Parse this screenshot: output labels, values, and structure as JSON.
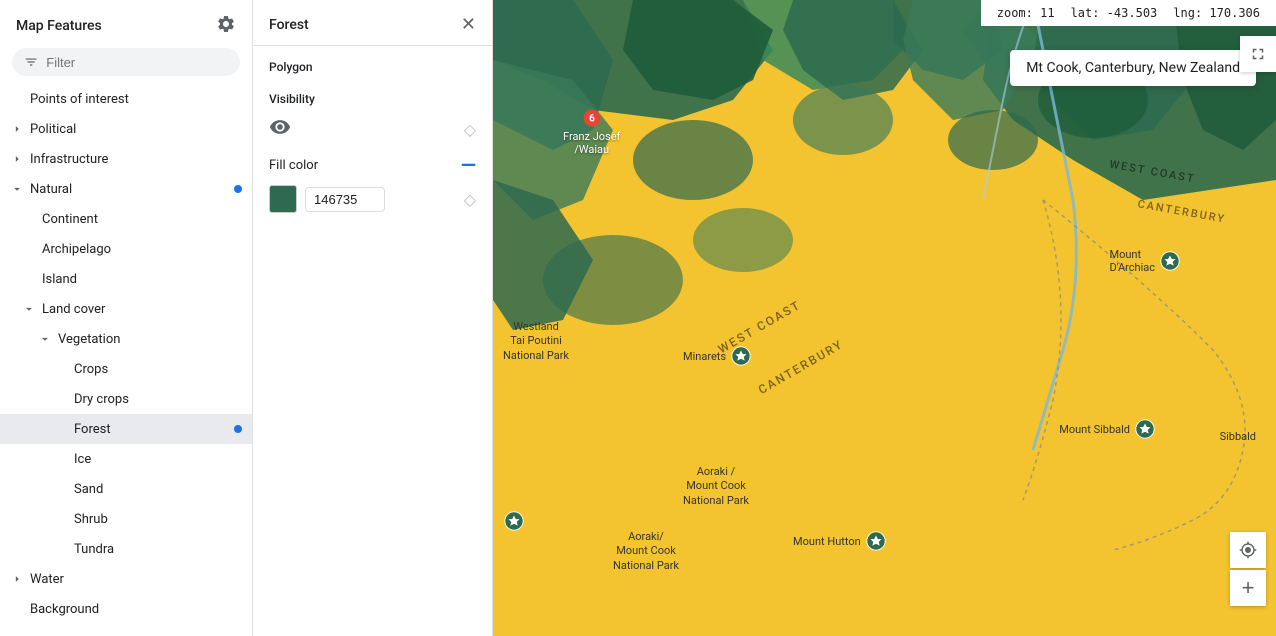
{
  "app": {
    "title": "Map Features",
    "filter_placeholder": "Filter"
  },
  "forest_panel": {
    "title": "Forest",
    "section_polygon": "Polygon",
    "section_visibility": "Visibility",
    "section_fill_color": "Fill color",
    "hex_value": "146735"
  },
  "map": {
    "zoom_label": "zoom:",
    "zoom_value": "11",
    "lat_label": "lat:",
    "lat_value": "-43.503",
    "lng_label": "lng:",
    "lng_value": "170.306",
    "location_name": "Mt Cook, Canterbury, New Zealand"
  },
  "sidebar": {
    "items": [
      {
        "id": "points-of-interest",
        "label": "Points of interest",
        "indent": 1,
        "has_chevron": false,
        "chevron_open": false,
        "active": false,
        "has_dot": false
      },
      {
        "id": "political",
        "label": "Political",
        "indent": 1,
        "has_chevron": true,
        "chevron_open": false,
        "active": false,
        "has_dot": false
      },
      {
        "id": "infrastructure",
        "label": "Infrastructure",
        "indent": 1,
        "has_chevron": true,
        "chevron_open": false,
        "active": false,
        "has_dot": false
      },
      {
        "id": "natural",
        "label": "Natural",
        "indent": 1,
        "has_chevron": true,
        "chevron_open": true,
        "active": false,
        "has_dot": true
      },
      {
        "id": "continent",
        "label": "Continent",
        "indent": 2,
        "has_chevron": false,
        "chevron_open": false,
        "active": false,
        "has_dot": false
      },
      {
        "id": "archipelago",
        "label": "Archipelago",
        "indent": 2,
        "has_chevron": false,
        "chevron_open": false,
        "active": false,
        "has_dot": false
      },
      {
        "id": "island",
        "label": "Island",
        "indent": 2,
        "has_chevron": false,
        "chevron_open": false,
        "active": false,
        "has_dot": false
      },
      {
        "id": "land-cover",
        "label": "Land cover",
        "indent": 2,
        "has_chevron": true,
        "chevron_open": true,
        "active": false,
        "has_dot": false
      },
      {
        "id": "vegetation",
        "label": "Vegetation",
        "indent": 3,
        "has_chevron": true,
        "chevron_open": true,
        "active": false,
        "has_dot": false
      },
      {
        "id": "crops",
        "label": "Crops",
        "indent": 4,
        "has_chevron": false,
        "chevron_open": false,
        "active": false,
        "has_dot": false
      },
      {
        "id": "dry-crops",
        "label": "Dry crops",
        "indent": 4,
        "has_chevron": false,
        "chevron_open": false,
        "active": false,
        "has_dot": false
      },
      {
        "id": "forest",
        "label": "Forest",
        "indent": 4,
        "has_chevron": false,
        "chevron_open": false,
        "active": true,
        "has_dot": true
      },
      {
        "id": "ice",
        "label": "Ice",
        "indent": 4,
        "has_chevron": false,
        "chevron_open": false,
        "active": false,
        "has_dot": false
      },
      {
        "id": "sand",
        "label": "Sand",
        "indent": 4,
        "has_chevron": false,
        "chevron_open": false,
        "active": false,
        "has_dot": false
      },
      {
        "id": "shrub",
        "label": "Shrub",
        "indent": 4,
        "has_chevron": false,
        "chevron_open": false,
        "active": false,
        "has_dot": false
      },
      {
        "id": "tundra",
        "label": "Tundra",
        "indent": 4,
        "has_chevron": false,
        "chevron_open": false,
        "active": false,
        "has_dot": false
      },
      {
        "id": "water",
        "label": "Water",
        "indent": 1,
        "has_chevron": true,
        "chevron_open": false,
        "active": false,
        "has_dot": false
      },
      {
        "id": "background",
        "label": "Background",
        "indent": 1,
        "has_chevron": false,
        "chevron_open": false,
        "active": false,
        "has_dot": false
      }
    ]
  }
}
